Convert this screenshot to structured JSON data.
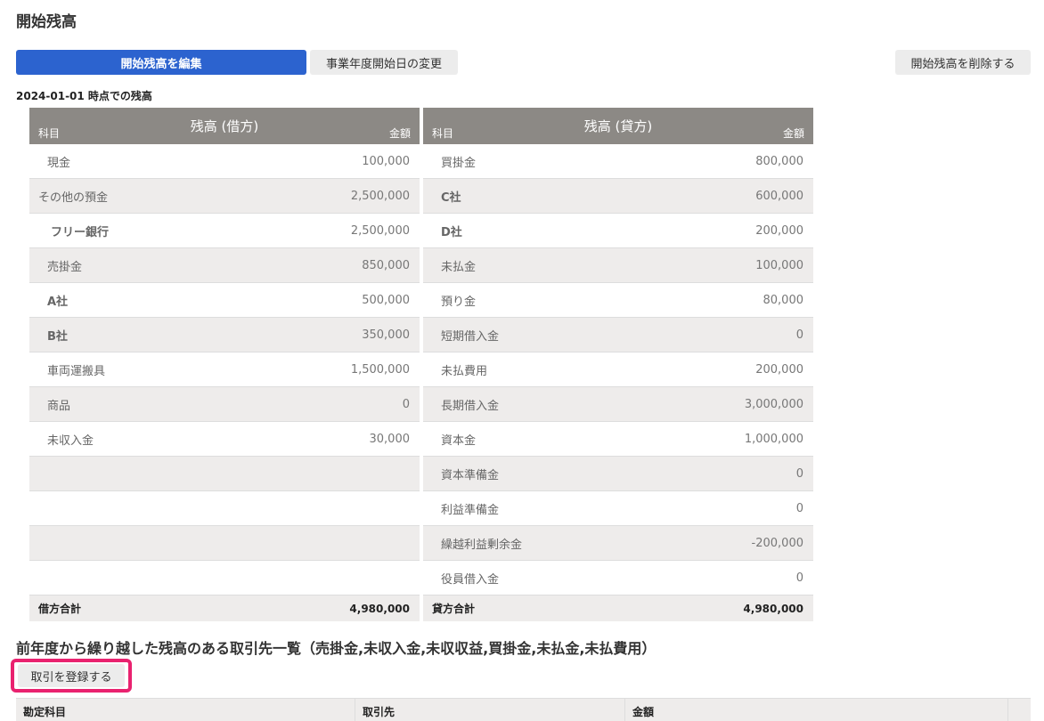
{
  "page": {
    "title": "開始残高"
  },
  "toolbar": {
    "edit_label": "開始残高を編集",
    "fiscal_year_label": "事業年度開始日の変更",
    "delete_label": "開始残高を削除する"
  },
  "as_of_text": "2024-01-01 時点での残高",
  "balance": {
    "debit_title": "残高 (借方)",
    "credit_title": "残高 (貸方)",
    "account_header": "科目",
    "amount_header": "金額",
    "rows": [
      {
        "debit_account": "現金",
        "debit_amount": "100,000",
        "credit_account": "買掛金",
        "credit_amount": "800,000"
      },
      {
        "debit_account": "その他の預金",
        "debit_amount": "2,500,000",
        "credit_account": "C社",
        "credit_amount": "600,000"
      },
      {
        "debit_account": "フリー銀行",
        "debit_amount": "2,500,000",
        "credit_account": "D社",
        "credit_amount": "200,000"
      },
      {
        "debit_account": "売掛金",
        "debit_amount": "850,000",
        "credit_account": "未払金",
        "credit_amount": "100,000"
      },
      {
        "debit_account": "A社",
        "debit_amount": "500,000",
        "credit_account": "預り金",
        "credit_amount": "80,000"
      },
      {
        "debit_account": "B社",
        "debit_amount": "350,000",
        "credit_account": "短期借入金",
        "credit_amount": "0"
      },
      {
        "debit_account": "車両運搬具",
        "debit_amount": "1,500,000",
        "credit_account": "未払費用",
        "credit_amount": "200,000"
      },
      {
        "debit_account": "商品",
        "debit_amount": "0",
        "credit_account": "長期借入金",
        "credit_amount": "3,000,000"
      },
      {
        "debit_account": "未収入金",
        "debit_amount": "30,000",
        "credit_account": "資本金",
        "credit_amount": "1,000,000"
      },
      {
        "debit_account": "",
        "debit_amount": "",
        "credit_account": "資本準備金",
        "credit_amount": "0"
      },
      {
        "debit_account": "",
        "debit_amount": "",
        "credit_account": "利益準備金",
        "credit_amount": "0"
      },
      {
        "debit_account": "",
        "debit_amount": "",
        "credit_account": "繰越利益剰余金",
        "credit_amount": "-200,000"
      },
      {
        "debit_account": "",
        "debit_amount": "",
        "credit_account": "役員借入金",
        "credit_amount": "0"
      }
    ],
    "debit_total_label": "借方合計",
    "debit_total": "4,980,000",
    "credit_total_label": "貸方合計",
    "credit_total": "4,980,000"
  },
  "partners": {
    "title": "前年度から繰り越した残高のある取引先一覧（売掛金,未収入金,未収収益,買掛金,未払金,未払費用）",
    "register_label": "取引を登録する",
    "columns": [
      "勘定科目",
      "取引先",
      "金額"
    ]
  },
  "colors": {
    "primary": "#2c63cf",
    "highlight": "#e9226f",
    "header_bg": "#8c8985"
  }
}
